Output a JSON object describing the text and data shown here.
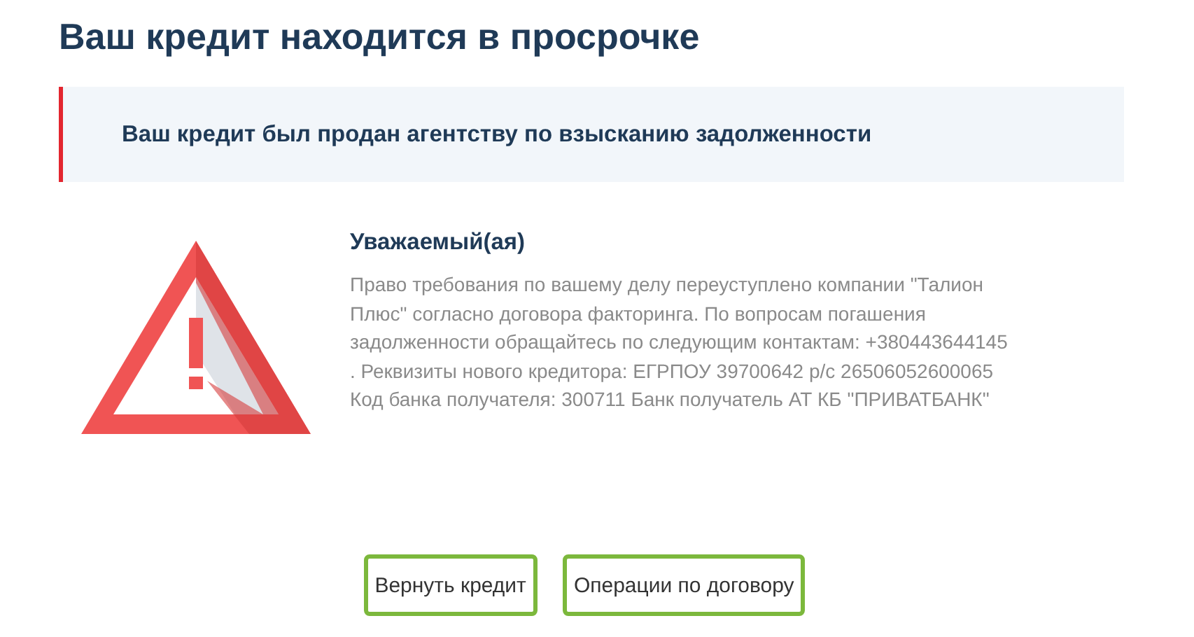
{
  "title": "Ваш кредит находится в просрочке",
  "alert": {
    "text": "Ваш кредит был продан агентству по взысканию задолженности"
  },
  "message": {
    "heading": "Уважаемый(ая)",
    "lines": [
      "Право требования по вашему делу переуступлено компании \"Талион",
      "Плюс\" согласно договора факторинга. По вопросам погашения",
      "задолженности обращайтесь по следующим контактам: +380443644145",
      ". Реквизиты нового кредитора: ЕГРПОУ 39700642 р/с 26506052600065",
      "Код банка получателя: 300711 Банк получатель АТ КБ \"ПРИВАТБАНК\""
    ]
  },
  "buttons": [
    "Вернуть кредит",
    "Операции по договору"
  ]
}
